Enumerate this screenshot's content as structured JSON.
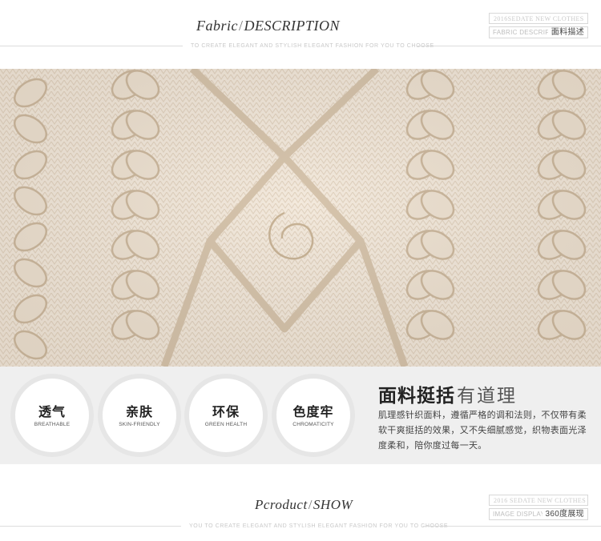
{
  "fabric_header": {
    "title_italic": "Fabric",
    "title_caps": "DESCRIPTION",
    "subtitle": "TO CREATE ELEGANT AND STYLISH ELEGANT FASHION FOR YOU TO CHOOSE",
    "tag_top": "2016SEDATE NEW CLOTHES",
    "tag_bottom_en": "FABRIC DESCRIPTION",
    "tag_bottom_cn": "面料描述"
  },
  "features": [
    {
      "cn": "透气",
      "en": "BREATHABLE"
    },
    {
      "cn": "亲肤",
      "en": "SKIN-FRIENDLY"
    },
    {
      "cn": "环保",
      "en": "GREEN HEALTH"
    },
    {
      "cn": "色度牢",
      "en": "CHROMATICITY"
    }
  ],
  "fabric_info": {
    "title_bold": "面料挺括",
    "title_light": "有道理",
    "description": "肌理感针织面料，遵循严格的调和法则，不仅带有柔软干爽挺括的效果，又不失细腻感觉，织物表面光泽度柔和，陪你度过每一天。"
  },
  "product_header": {
    "title_italic": "Pcroduct",
    "title_caps": "SHOW",
    "subtitle": "YOU TO CREATE ELEGANT AND STYLISH ELEGANT FASHION FOR YOU TO CHOOSE",
    "tag_top": "2016 SEDATE NEW CLOTHES",
    "tag_bottom_en": "IMAGE DISPLAY",
    "tag_bottom_cn": "360度展现"
  },
  "colors": {
    "knit": "#f3e9dc",
    "band": "#efefef",
    "ring": "#e6e6e6"
  }
}
